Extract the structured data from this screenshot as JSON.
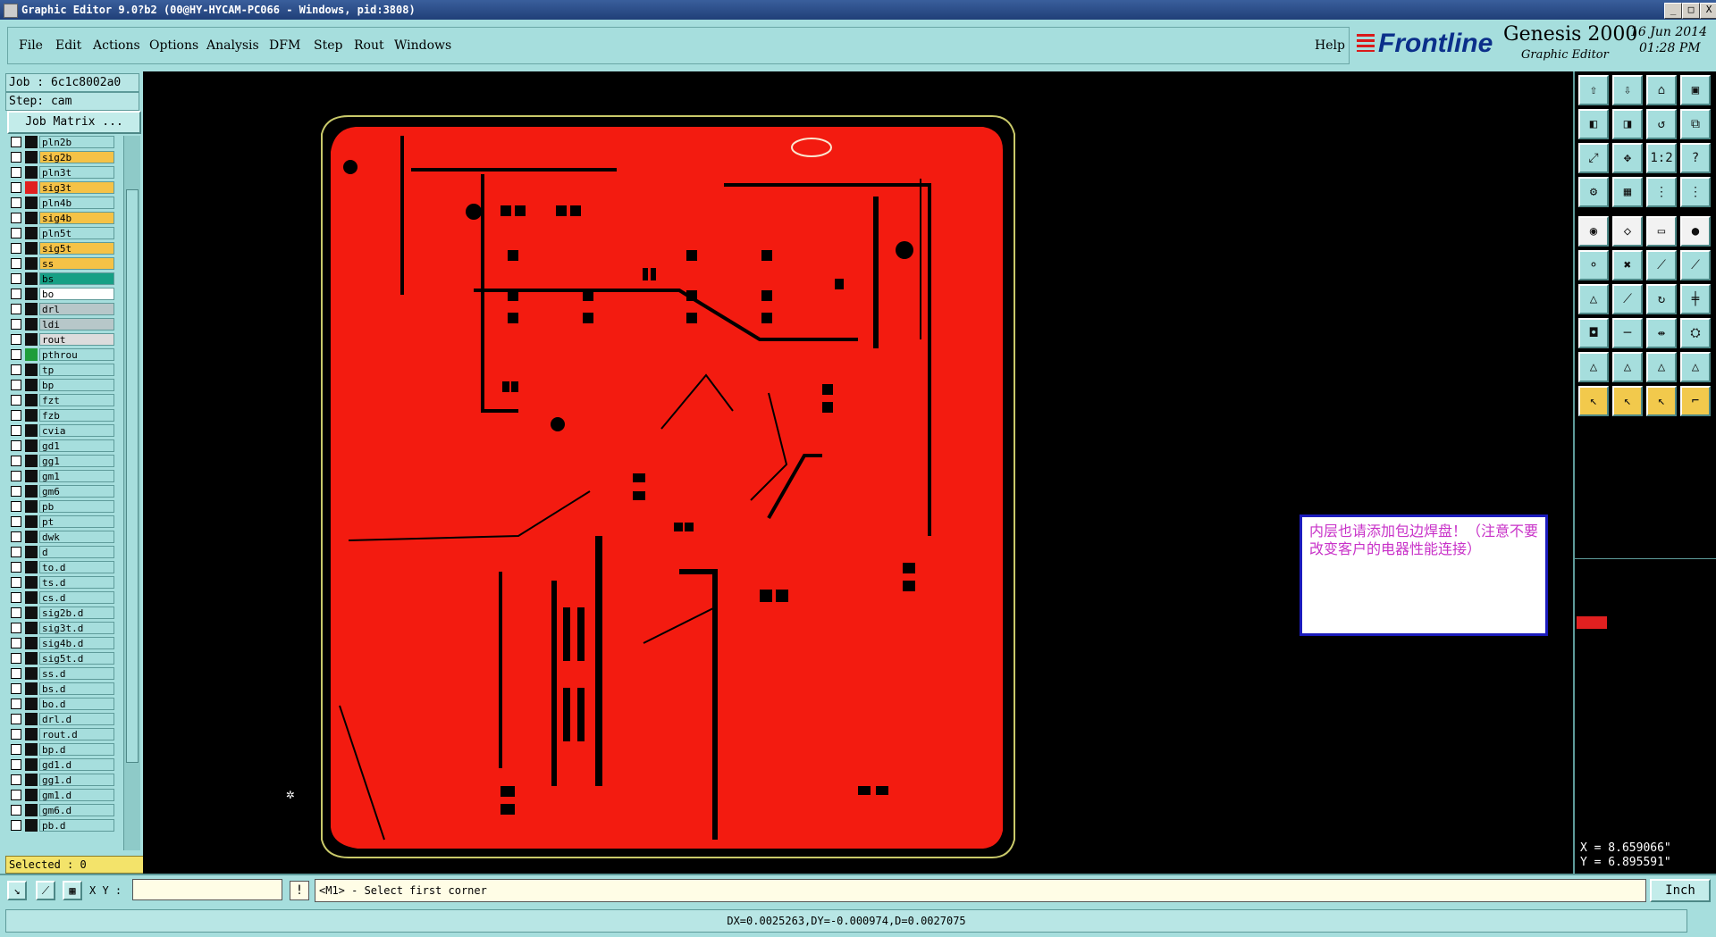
{
  "window": {
    "title": "Graphic Editor 9.0?b2 (00@HY-HYCAM-PC066 - Windows, pid:3808)",
    "min": "_",
    "max": "□",
    "close": "X"
  },
  "menu": {
    "file": "File",
    "edit": "Edit",
    "actions": "Actions",
    "options": "Options",
    "analysis": "Analysis",
    "dfm": "DFM",
    "step": "Step",
    "rout": "Rout",
    "windows": "Windows",
    "help": "Help"
  },
  "brand": {
    "logo": "Frontline",
    "product": "Genesis 2000",
    "subtitle": "Graphic Editor",
    "date": "16 Jun 2014",
    "time": "01:28 PM"
  },
  "job": {
    "job_label": "Job : 6c1c8002a0",
    "step_label": "Step: cam",
    "matrix_button": "Job Matrix ..."
  },
  "layers": [
    {
      "name": "pln2b",
      "color": "#a6dedd",
      "swatch": "#111"
    },
    {
      "name": "sig2b",
      "color": "#f5c246",
      "swatch": "#111"
    },
    {
      "name": "pln3t",
      "color": "#a6dedd",
      "swatch": "#111"
    },
    {
      "name": "sig3t",
      "color": "#f5c246",
      "swatch": "#e02020"
    },
    {
      "name": "pln4b",
      "color": "#a6dedd",
      "swatch": "#111"
    },
    {
      "name": "sig4b",
      "color": "#f5c246",
      "swatch": "#111"
    },
    {
      "name": "pln5t",
      "color": "#a6dedd",
      "swatch": "#111"
    },
    {
      "name": "sig5t",
      "color": "#f5c246",
      "swatch": "#111"
    },
    {
      "name": "ss",
      "color": "#f5c246",
      "swatch": "#111"
    },
    {
      "name": "bs",
      "color": "#16a085",
      "swatch": "#111"
    },
    {
      "name": "bo",
      "color": "#ffffff",
      "swatch": "#111"
    },
    {
      "name": "drl",
      "color": "#b7c7c9",
      "swatch": "#111"
    },
    {
      "name": "ldi",
      "color": "#b7c7c9",
      "swatch": "#111"
    },
    {
      "name": "rout",
      "color": "#dcdcdc",
      "swatch": "#111"
    },
    {
      "name": "pthrou",
      "color": "#a6dedd",
      "swatch": "#1f9d3a"
    },
    {
      "name": "tp",
      "color": "#a6dedd",
      "swatch": "#111"
    },
    {
      "name": "bp",
      "color": "#a6dedd",
      "swatch": "#111"
    },
    {
      "name": "fzt",
      "color": "#a6dedd",
      "swatch": "#111"
    },
    {
      "name": "fzb",
      "color": "#a6dedd",
      "swatch": "#111"
    },
    {
      "name": "cvia",
      "color": "#a6dedd",
      "swatch": "#111"
    },
    {
      "name": "gd1",
      "color": "#a6dedd",
      "swatch": "#111"
    },
    {
      "name": "gg1",
      "color": "#a6dedd",
      "swatch": "#111"
    },
    {
      "name": "gm1",
      "color": "#a6dedd",
      "swatch": "#111"
    },
    {
      "name": "gm6",
      "color": "#a6dedd",
      "swatch": "#111"
    },
    {
      "name": "pb",
      "color": "#a6dedd",
      "swatch": "#111"
    },
    {
      "name": "pt",
      "color": "#a6dedd",
      "swatch": "#111"
    },
    {
      "name": "dwk",
      "color": "#a6dedd",
      "swatch": "#111"
    },
    {
      "name": "d",
      "color": "#a6dedd",
      "swatch": "#111"
    },
    {
      "name": "to.d",
      "color": "#a6dedd",
      "swatch": "#111"
    },
    {
      "name": "ts.d",
      "color": "#a6dedd",
      "swatch": "#111"
    },
    {
      "name": "cs.d",
      "color": "#a6dedd",
      "swatch": "#111"
    },
    {
      "name": "sig2b.d",
      "color": "#a6dedd",
      "swatch": "#111"
    },
    {
      "name": "sig3t.d",
      "color": "#a6dedd",
      "swatch": "#111"
    },
    {
      "name": "sig4b.d",
      "color": "#a6dedd",
      "swatch": "#111"
    },
    {
      "name": "sig5t.d",
      "color": "#a6dedd",
      "swatch": "#111"
    },
    {
      "name": "ss.d",
      "color": "#a6dedd",
      "swatch": "#111"
    },
    {
      "name": "bs.d",
      "color": "#a6dedd",
      "swatch": "#111"
    },
    {
      "name": "bo.d",
      "color": "#a6dedd",
      "swatch": "#111"
    },
    {
      "name": "drl.d",
      "color": "#a6dedd",
      "swatch": "#111"
    },
    {
      "name": "rout.d",
      "color": "#a6dedd",
      "swatch": "#111"
    },
    {
      "name": "bp.d",
      "color": "#a6dedd",
      "swatch": "#111"
    },
    {
      "name": "gd1.d",
      "color": "#a6dedd",
      "swatch": "#111"
    },
    {
      "name": "gg1.d",
      "color": "#a6dedd",
      "swatch": "#111"
    },
    {
      "name": "gm1.d",
      "color": "#a6dedd",
      "swatch": "#111"
    },
    {
      "name": "gm6.d",
      "color": "#a6dedd",
      "swatch": "#111"
    },
    {
      "name": "pb.d",
      "color": "#a6dedd",
      "swatch": "#111"
    }
  ],
  "selected": "Selected : 0",
  "note": "内层也请添加包边焊盘！（注意不要改变客户的电器性能连接）",
  "coords": {
    "x": "X = 8.659066\"",
    "y": "Y = 6.895591\""
  },
  "bottom": {
    "xy_label": "X Y :",
    "xy_value": "",
    "excl": "!",
    "prompt": "<M1> - Select first corner",
    "unit": "Inch"
  },
  "status": "DX=0.0025263,DY=-0.000974,D=0.0027075",
  "colors": {
    "board": "#f31b10",
    "panel": "#a6dedd",
    "outline": "#c9c96a"
  }
}
